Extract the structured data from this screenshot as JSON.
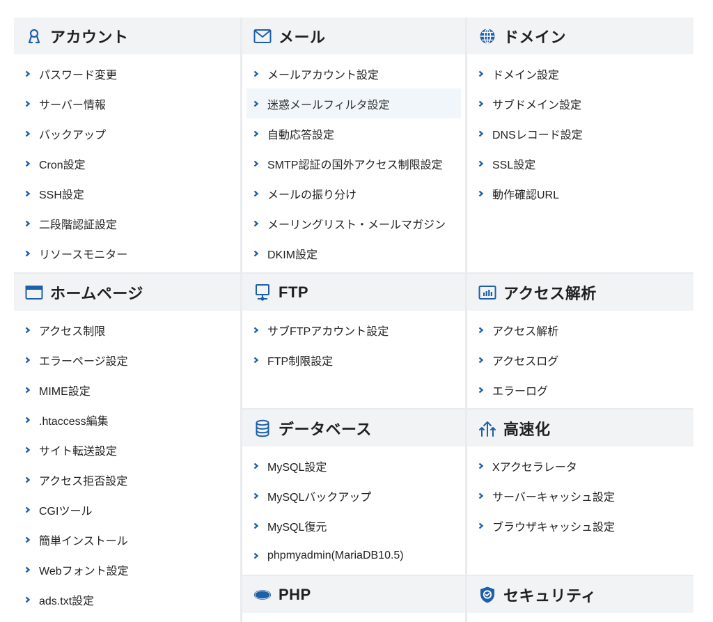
{
  "account": {
    "title": "アカウント",
    "items": [
      "パスワード変更",
      "サーバー情報",
      "バックアップ",
      "Cron設定",
      "SSH設定",
      "二段階認証設定",
      "リソースモニター"
    ]
  },
  "mail": {
    "title": "メール",
    "items": [
      "メールアカウント設定",
      "迷惑メールフィルタ設定",
      "自動応答設定",
      "SMTP認証の国外アクセス制限設定",
      "メールの振り分け",
      "メーリングリスト・メールマガジン",
      "DKIM設定"
    ]
  },
  "domain": {
    "title": "ドメイン",
    "items": [
      "ドメイン設定",
      "サブドメイン設定",
      "DNSレコード設定",
      "SSL設定",
      "動作確認URL"
    ]
  },
  "homepage": {
    "title": "ホームページ",
    "items": [
      "アクセス制限",
      "エラーページ設定",
      "MIME設定",
      ".htaccess編集",
      "サイト転送設定",
      "アクセス拒否設定",
      "CGIツール",
      "簡単インストール",
      "Webフォント設定",
      "ads.txt設定"
    ]
  },
  "ftp": {
    "title": "FTP",
    "items": [
      "サブFTPアカウント設定",
      "FTP制限設定"
    ]
  },
  "access_analysis": {
    "title": "アクセス解析",
    "items": [
      "アクセス解析",
      "アクセスログ",
      "エラーログ"
    ]
  },
  "database": {
    "title": "データベース",
    "items": [
      "MySQL設定",
      "MySQLバックアップ",
      "MySQL復元",
      "phpmyadmin(MariaDB10.5)"
    ]
  },
  "speed": {
    "title": "高速化",
    "items": [
      "Xアクセラレータ",
      "サーバーキャッシュ設定",
      "ブラウザキャッシュ設定"
    ]
  },
  "php": {
    "title": "PHP",
    "icon_text": "php"
  },
  "security": {
    "title": "セキュリティ"
  },
  "colors": {
    "accent": "#1d5fa8",
    "header_bg": "#f2f3f5",
    "divider": "#e9ebee"
  }
}
